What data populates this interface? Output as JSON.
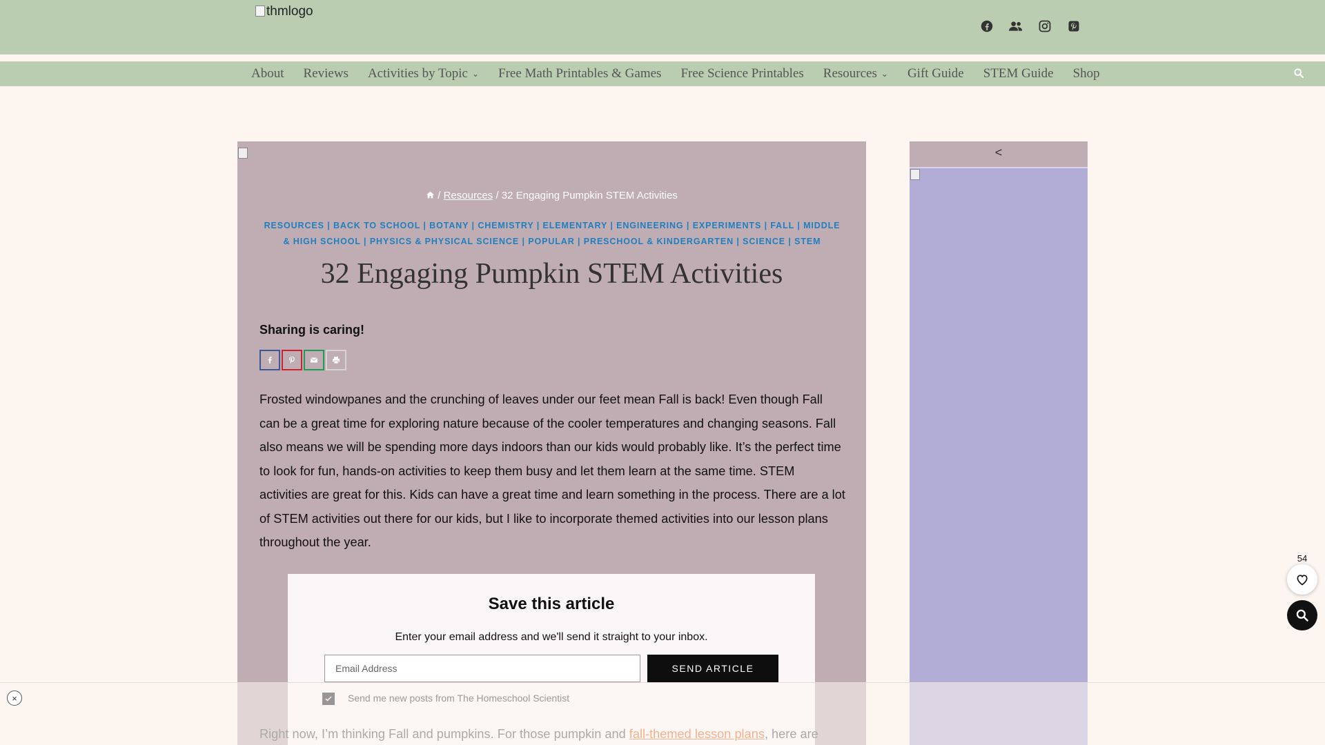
{
  "header": {
    "logo_alt": "thmlogo",
    "social_icons": [
      "facebook-icon",
      "group-icon",
      "instagram-icon",
      "pinterest-icon"
    ]
  },
  "nav": {
    "items": [
      {
        "label": "About",
        "dropdown": false
      },
      {
        "label": "Reviews",
        "dropdown": false
      },
      {
        "label": "Activities by Topic",
        "dropdown": true
      },
      {
        "label": "Free Math Printables & Games",
        "dropdown": false
      },
      {
        "label": "Free Science Printables",
        "dropdown": false
      },
      {
        "label": "Resources",
        "dropdown": true
      },
      {
        "label": "Gift Guide",
        "dropdown": false
      },
      {
        "label": "STEM Guide",
        "dropdown": false
      },
      {
        "label": "Shop",
        "dropdown": false
      }
    ]
  },
  "breadcrumb": {
    "sep": "/",
    "resources": "Resources",
    "current": "32 Engaging Pumpkin STEM Activities"
  },
  "categories": "RESOURCES | BACK TO SCHOOL | BOTANY | CHEMISTRY | ELEMENTARY | ENGINEERING | EXPERIMENTS | FALL | MIDDLE & HIGH SCHOOL | PHYSICS & PHYSICAL SCIENCE | POPULAR | PRESCHOOL & KINDERGARTEN | SCIENCE | STEM",
  "article": {
    "title": "32 Engaging Pumpkin STEM Activities",
    "sharing_label": "Sharing is caring!",
    "intro": "Frosted windowpanes and the crunching of leaves under our feet mean Fall is back! Even though Fall can be a great time for exploring nature because of the cooler temperatures and changing seasons. Fall also means we will be spending more days indoors than our kids would probably like. It’s the perfect time to look for fun, hands-on activities to keep them busy and let them learn at the same time. STEM activities are great for this. Kids can have a great time and learn something in the process. There are a lot of STEM activities out there for our kids, but I like to incorporate themed activities into our lesson plans throughout the year.",
    "next_before": "Right now, I’m thinking Fall and pumpkins. For those pumpkin and ",
    "next_link": "fall-themed lesson plans",
    "next_after": ", here are"
  },
  "share_buttons": [
    {
      "name": "facebook",
      "color": "#3b5998"
    },
    {
      "name": "pinterest",
      "color": "#c8232c"
    },
    {
      "name": "email",
      "color": "#1f9d55"
    },
    {
      "name": "print",
      "color": "#888888"
    }
  ],
  "save_article": {
    "title": "Save this article",
    "description": "Enter your email address and we'll send it straight to your inbox.",
    "email_placeholder": "Email Address",
    "button": "SEND ARTICLE",
    "checkbox_label": "Send me new posts from The Homeschool Scientist"
  },
  "sidebar": {
    "toggle": "<"
  },
  "floating": {
    "heart_count": "54"
  },
  "overlay": {
    "close": "×"
  }
}
